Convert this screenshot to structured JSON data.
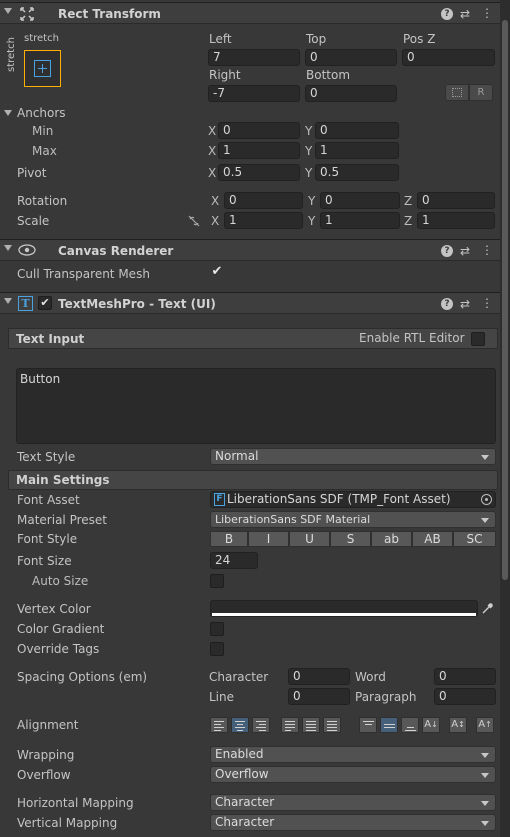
{
  "rect_transform": {
    "title": "Rect Transform",
    "preset_label": "stretch",
    "preset_side_label": "stretch",
    "left_label": "Left",
    "left": "7",
    "top_label": "Top",
    "top": "0",
    "posz_label": "Pos Z",
    "posz": "0",
    "right_label": "Right",
    "right": "-7",
    "bottom_label": "Bottom",
    "bottom": "0",
    "r_button": "R",
    "anchors_label": "Anchors",
    "min_label": "Min",
    "min_x": "0",
    "min_y": "0",
    "max_label": "Max",
    "max_x": "1",
    "max_y": "1",
    "pivot_label": "Pivot",
    "pivot_x": "0.5",
    "pivot_y": "0.5",
    "rotation_label": "Rotation",
    "rot_x": "0",
    "rot_y": "0",
    "rot_z": "0",
    "scale_label": "Scale",
    "scale_x": "1",
    "scale_y": "1",
    "scale_z": "1",
    "axis_x": "X",
    "axis_y": "Y",
    "axis_z": "Z"
  },
  "canvas_renderer": {
    "title": "Canvas Renderer",
    "cull_label": "Cull Transparent Mesh",
    "cull_checked": true
  },
  "tmp": {
    "title": "TextMeshPro - Text (UI)",
    "text_input_label": "Text Input",
    "rtl_label": "Enable RTL Editor",
    "text_value": "Button",
    "text_style_label": "Text Style",
    "text_style_value": "Normal",
    "main_settings_label": "Main Settings",
    "font_asset_label": "Font Asset",
    "font_asset_value": "LiberationSans SDF (TMP_Font Asset)",
    "material_preset_label": "Material Preset",
    "material_preset_value": "LiberationSans SDF Material",
    "font_style_label": "Font Style",
    "font_style_buttons": [
      "B",
      "I",
      "U",
      "S",
      "ab",
      "AB",
      "SC"
    ],
    "font_size_label": "Font Size",
    "font_size_value": "24",
    "auto_size_label": "Auto Size",
    "vertex_color_label": "Vertex Color",
    "vertex_color": "#ffffff",
    "color_gradient_label": "Color Gradient",
    "override_tags_label": "Override Tags",
    "spacing_label": "Spacing Options (em)",
    "character_label": "Character",
    "character_value": "0",
    "word_label": "Word",
    "word_value": "0",
    "line_label": "Line",
    "line_value": "0",
    "paragraph_label": "Paragraph",
    "paragraph_value": "0",
    "alignment_label": "Alignment",
    "wrapping_label": "Wrapping",
    "wrapping_value": "Enabled",
    "overflow_label": "Overflow",
    "overflow_value": "Overflow",
    "hmap_label": "Horizontal Mapping",
    "hmap_value": "Character",
    "vmap_label": "Vertical Mapping",
    "vmap_value": "Character"
  },
  "colors": {
    "accent": "#46607c",
    "icon_blue": "#4aa3e0"
  }
}
